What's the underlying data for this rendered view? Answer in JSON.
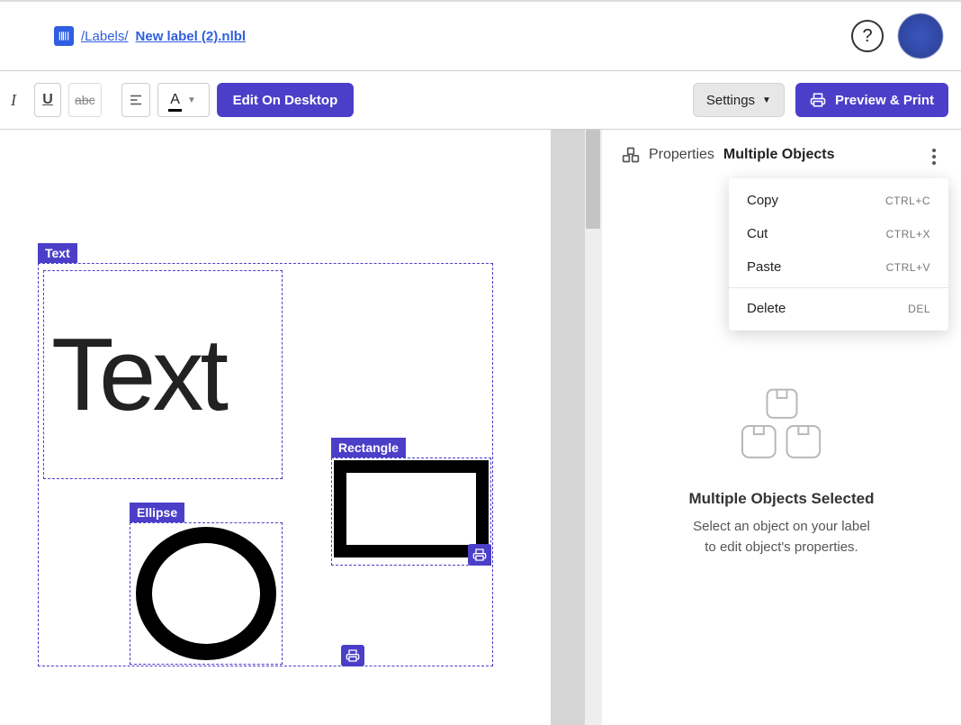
{
  "breadcrumb": {
    "path": "/Labels/",
    "file": "New label (2).nlbl"
  },
  "toolbar": {
    "italic_label": "I",
    "underline_label": "U",
    "strike_label": "abc",
    "fontcolor_label": "A",
    "edit_desktop": "Edit On Desktop",
    "settings": "Settings",
    "preview": "Preview & Print"
  },
  "canvas": {
    "text_tag": "Text",
    "text_value": "Text",
    "ellipse_tag": "Ellipse",
    "rectangle_tag": "Rectangle"
  },
  "panel": {
    "label": "Properties",
    "value": "Multiple Objects",
    "multi_title": "Multiple Objects Selected",
    "multi_desc1": "Select an object on your label",
    "multi_desc2": "to edit object's properties."
  },
  "ctx": {
    "copy": "Copy",
    "copy_sc": "CTRL+C",
    "cut": "Cut",
    "cut_sc": "CTRL+X",
    "paste": "Paste",
    "paste_sc": "CTRL+V",
    "delete": "Delete",
    "delete_sc": "DEL"
  }
}
